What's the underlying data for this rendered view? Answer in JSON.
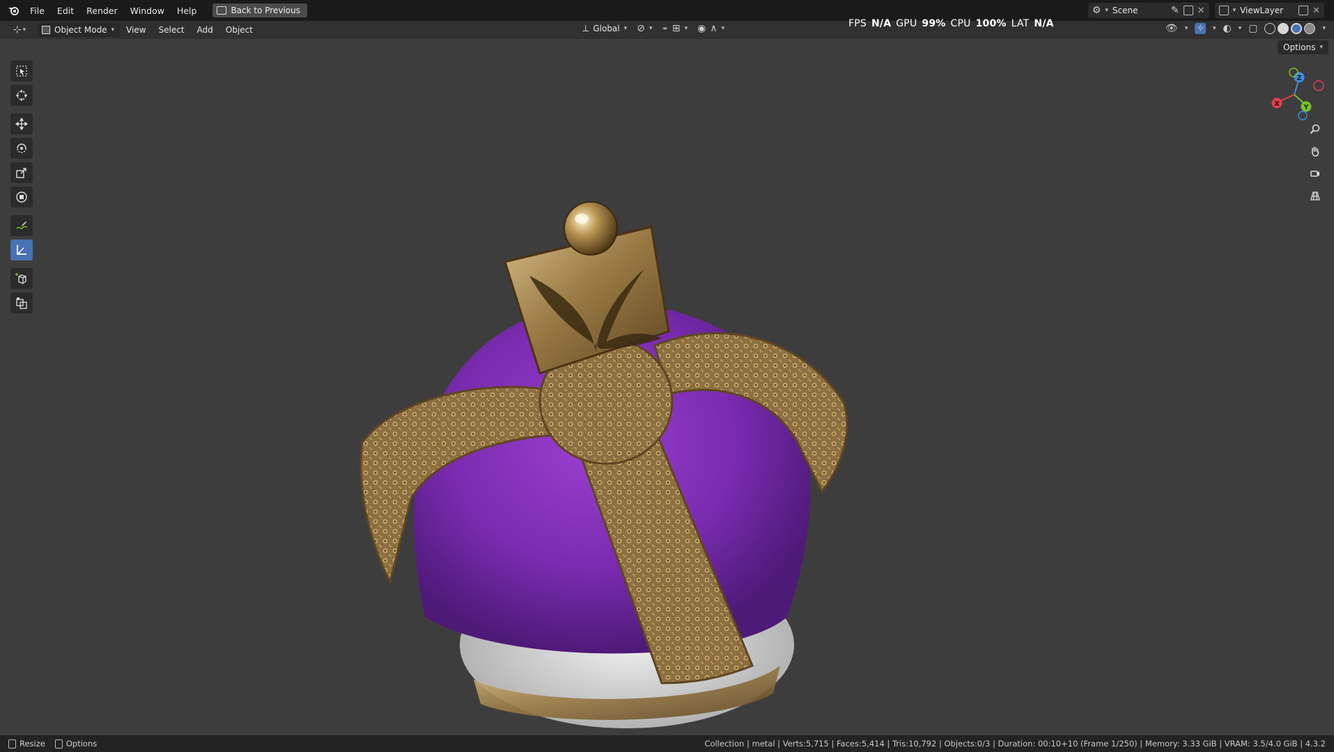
{
  "topbar": {
    "menus": [
      "File",
      "Edit",
      "Render",
      "Window",
      "Help"
    ],
    "back_button": "Back to Previous",
    "scene_name": "Scene",
    "view_layer": "ViewLayer"
  },
  "header": {
    "mode": "Object Mode",
    "menus": [
      "View",
      "Select",
      "Add",
      "Object"
    ],
    "orientation": "Global",
    "options_label": "Options"
  },
  "hud": {
    "fps_label": "FPS",
    "fps_value": "N/A",
    "gpu_label": "GPU",
    "gpu_value": "99%",
    "cpu_label": "CPU",
    "cpu_value": "100%",
    "lat_label": "LAT",
    "lat_value": "N/A"
  },
  "gizmo": {
    "z": "Z",
    "x": "X",
    "y": "Y"
  },
  "toolbar": {
    "tools": [
      {
        "name": "select-box-tool",
        "icon": "select-box-icon"
      },
      {
        "name": "cursor-tool",
        "icon": "cursor-icon"
      },
      {
        "name": "move-tool",
        "icon": "move-icon"
      },
      {
        "name": "rotate-tool",
        "icon": "rotate-icon"
      },
      {
        "name": "scale-tool",
        "icon": "scale-icon"
      },
      {
        "name": "transform-tool",
        "icon": "transform-icon"
      },
      {
        "name": "annotate-tool",
        "icon": "annotate-icon"
      },
      {
        "name": "measure-tool",
        "icon": "measure-icon"
      },
      {
        "name": "add-cube-tool",
        "icon": "add-cube-icon"
      },
      {
        "name": "extra-tool",
        "icon": "extra-icon"
      }
    ],
    "active_tool": "measure-tool"
  },
  "statusbar": {
    "resize": "Resize",
    "options": "Options",
    "info": "Collection | metal | Verts:5,715 | Faces:5,414 | Tris:10,792 | Objects:0/3 | Duration: 00:10+10 (Frame 1/250) | Memory: 3.33 GiB | VRAM: 3.5/4.0 GiB | 4.3.2"
  },
  "colors": {
    "viewport_bg": "#3d3d3d",
    "accent_blue": "#4772b3",
    "velvet": "#7a2bb0",
    "gold": "#a88a52",
    "fur": "#d8d8d8",
    "axis_x": "#e0404c",
    "axis_y": "#7cc02c",
    "axis_z": "#3f8ce0"
  }
}
